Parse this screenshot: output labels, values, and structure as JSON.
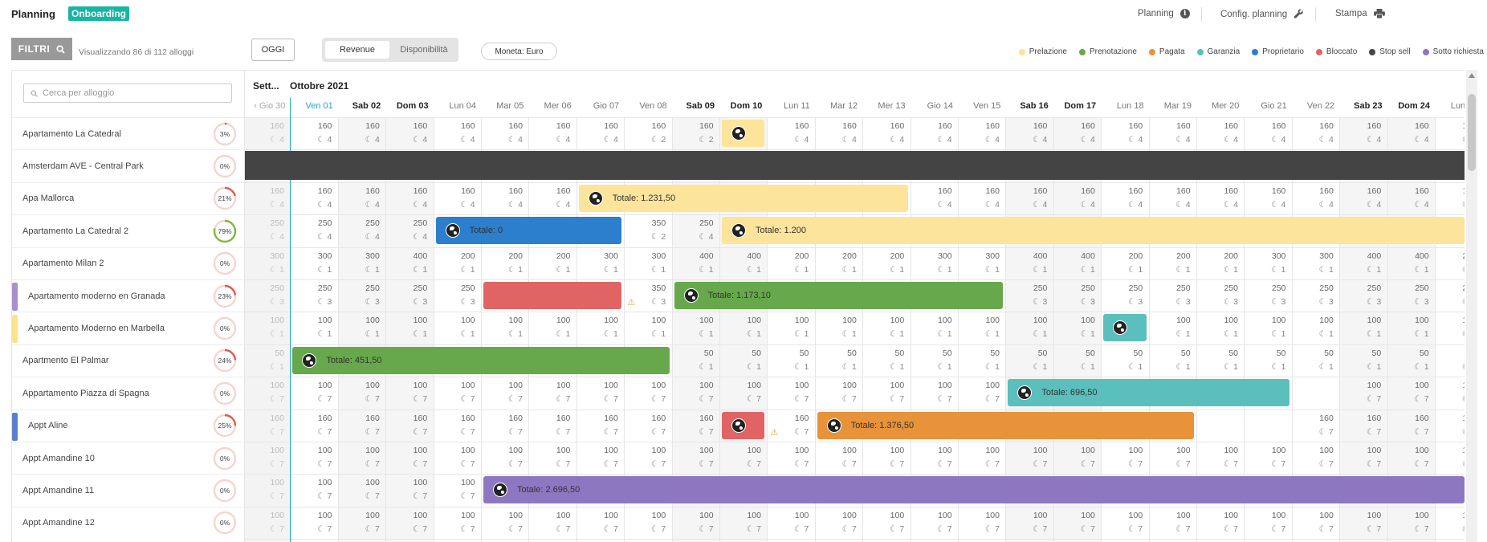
{
  "app": {
    "title": "Planning",
    "badge": "Onboarding"
  },
  "top_links": [
    {
      "label": "Planning",
      "icon": "info-icon"
    },
    {
      "label": "Config. planning",
      "icon": "wrench-icon"
    },
    {
      "label": "Stampa",
      "icon": "printer-icon"
    }
  ],
  "toolbar": {
    "filters_label": "FILTRI",
    "visual_text": "Visualizzando 86 di 112 alloggi",
    "today_label": "OGGI",
    "toggle": {
      "revenue": "Revenue",
      "availability": "Disponibilità",
      "active": "Revenue"
    },
    "currency": "Moneta: Euro"
  },
  "legend": [
    {
      "label": "Prelazione",
      "color": "#fde49b"
    },
    {
      "label": "Prenotazione",
      "color": "#67a84c"
    },
    {
      "label": "Pagata",
      "color": "#e8923a"
    },
    {
      "label": "Garanzia",
      "color": "#5bbfbd"
    },
    {
      "label": "Proprietario",
      "color": "#2b7fcc"
    },
    {
      "label": "Bloccato",
      "color": "#e06464"
    },
    {
      "label": "Stop sell",
      "color": "#444444"
    },
    {
      "label": "Sotto richiesta",
      "color": "#8e77c1"
    }
  ],
  "search": {
    "placeholder": "Cerca per alloggio"
  },
  "properties": [
    {
      "name": "Apartamento La Catedral",
      "pct": "3%",
      "pct_value": 3,
      "stripe": null
    },
    {
      "name": "Amsterdam AVE - Central Park",
      "pct": "0%",
      "pct_value": 0,
      "stripe": null
    },
    {
      "name": "Apa Mallorca",
      "pct": "21%",
      "pct_value": 21,
      "stripe": null
    },
    {
      "name": "Apartamento La Catedral 2",
      "pct": "79%",
      "pct_value": 79,
      "stripe": null
    },
    {
      "name": "Apartamento Milan 2",
      "pct": "0%",
      "pct_value": 0,
      "stripe": null
    },
    {
      "name": "Apartamento moderno en Granada",
      "pct": "23%",
      "pct_value": 23,
      "stripe": "#a98fcb"
    },
    {
      "name": "Apartamento Moderno en Marbella",
      "pct": "0%",
      "pct_value": 0,
      "stripe": "#fbe38d"
    },
    {
      "name": "Apartmento El Palmar",
      "pct": "24%",
      "pct_value": 24,
      "stripe": null
    },
    {
      "name": "Appartamento Piazza di Spagna",
      "pct": "0%",
      "pct_value": 0,
      "stripe": null
    },
    {
      "name": "Appt Aline",
      "pct": "25%",
      "pct_value": 25,
      "stripe": "#5b7fcf"
    },
    {
      "name": "Appt Amandine 10",
      "pct": "0%",
      "pct_value": 0,
      "stripe": null
    },
    {
      "name": "Appt Amandine 11",
      "pct": "0%",
      "pct_value": 0,
      "stripe": null
    },
    {
      "name": "Appt Amandine 12",
      "pct": "0%",
      "pct_value": 0,
      "stripe": null
    }
  ],
  "calendar": {
    "prev_month": "Sett...",
    "month": "Ottobre 2021",
    "days": [
      "Gio 30",
      "Ven 01",
      "Sab 02",
      "Dom 03",
      "Lun 04",
      "Mar 05",
      "Mer 06",
      "Gio 07",
      "Ven 08",
      "Sab 09",
      "Dom 10",
      "Lun 11",
      "Mar 12",
      "Mer 13",
      "Gio 14",
      "Ven 15",
      "Sab 16",
      "Dom 17",
      "Lun 18",
      "Mar 19",
      "Mer 20",
      "Gio 21",
      "Ven 22",
      "Sab 23",
      "Dom 24",
      "Lun 25"
    ],
    "weekend_idx": [
      2,
      3,
      9,
      10,
      16,
      17,
      23,
      24
    ],
    "today_idx": 1,
    "rows": [
      {
        "prices": [
          "160",
          "160",
          "160",
          "160",
          "160",
          "160",
          "160",
          "160",
          "160",
          "160",
          null,
          "160",
          "160",
          "160",
          "160",
          "160",
          "160",
          "160",
          "160",
          "160",
          "160",
          "160",
          "160",
          "160",
          "160",
          "160"
        ],
        "nights": [
          "4",
          "4",
          "4",
          "4",
          "4",
          "4",
          "4",
          "4",
          "2",
          "2",
          null,
          "4",
          "4",
          "4",
          "4",
          "4",
          "4",
          "4",
          "4",
          "4",
          "4",
          "4",
          "4",
          "4",
          "4",
          "1"
        ]
      },
      {
        "prices": [],
        "nights": []
      },
      {
        "prices": [
          "160",
          "160",
          "160",
          "160",
          "160",
          "160",
          "160",
          null,
          null,
          null,
          null,
          null,
          null,
          null,
          "160",
          "160",
          "160",
          "160",
          "160",
          "160",
          "160",
          "160",
          "160",
          "160",
          "160",
          "160"
        ],
        "nights": [
          "4",
          "4",
          "4",
          "4",
          "4",
          "4",
          "4",
          null,
          null,
          null,
          null,
          null,
          null,
          null,
          "4",
          "4",
          "4",
          "4",
          "4",
          "4",
          "4",
          "4",
          "4",
          "4",
          "4",
          "1"
        ]
      },
      {
        "prices": [
          "250",
          "250",
          "250",
          "250",
          null,
          null,
          null,
          null,
          "350",
          "250"
        ],
        "nights": [
          "4",
          "4",
          "4",
          "4",
          null,
          null,
          null,
          null,
          "2",
          "4"
        ]
      },
      {
        "prices": [
          "300",
          "300",
          "300",
          "400",
          "200",
          "200",
          "200",
          "300",
          "300",
          "400",
          "400",
          "200",
          "200",
          "200",
          "300",
          "300",
          "400",
          "400",
          "200",
          "200",
          "200",
          "300",
          "300",
          "400",
          "400",
          "200"
        ],
        "nights": [
          "1",
          "1",
          "1",
          "1",
          "1",
          "1",
          "1",
          "1",
          "1",
          "1",
          "1",
          "1",
          "1",
          "1",
          "1",
          "1",
          "1",
          "1",
          "1",
          "1",
          "1",
          "1",
          "1",
          "1",
          "1",
          "1"
        ]
      },
      {
        "prices": [
          "250",
          "250",
          "250",
          "250",
          "250",
          null,
          null,
          null,
          "350",
          null,
          null,
          null,
          null,
          null,
          null,
          null,
          "250",
          "250",
          "250",
          "250",
          "250",
          "250",
          "250",
          "250",
          "250",
          "250"
        ],
        "nights": [
          "3",
          "3",
          "3",
          "3",
          "3",
          null,
          null,
          null,
          "3",
          null,
          null,
          null,
          null,
          null,
          null,
          null,
          "3",
          "3",
          "3",
          "3",
          "3",
          "3",
          "3",
          "3",
          "3",
          "3"
        ]
      },
      {
        "prices": [
          "100",
          "100",
          "100",
          "100",
          "100",
          "100",
          "100",
          "100",
          "100",
          "100",
          "100",
          "100",
          "100",
          "100",
          "100",
          "100",
          "100",
          "100",
          null,
          "100",
          "100",
          "100",
          "100",
          "100",
          "100",
          "100"
        ],
        "nights": [
          "1",
          "1",
          "1",
          "1",
          "1",
          "1",
          "1",
          "1",
          "1",
          "1",
          "1",
          "1",
          "1",
          "1",
          "1",
          "1",
          "1",
          "1",
          null,
          "1",
          "1",
          "1",
          "1",
          "1",
          "1",
          "1"
        ]
      },
      {
        "prices": [
          "50",
          null,
          null,
          null,
          null,
          null,
          null,
          null,
          null,
          "50",
          "50",
          "50",
          "50",
          "50",
          "50",
          "50",
          "50",
          "50",
          "50",
          "50",
          "50",
          "50",
          "50",
          "50",
          "50",
          "50"
        ],
        "nights": [
          "1",
          null,
          null,
          null,
          null,
          null,
          null,
          null,
          null,
          "1",
          "1",
          "1",
          "1",
          "1",
          "1",
          "1",
          "1",
          "1",
          "1",
          "1",
          "1",
          "1",
          "1",
          "1",
          "1",
          "1"
        ]
      },
      {
        "prices": [
          "100",
          "100",
          "100",
          "100",
          "100",
          "100",
          "100",
          "100",
          "100",
          "100",
          "100",
          "100",
          "100",
          "100",
          "100",
          "100",
          null,
          null,
          null,
          null,
          null,
          null,
          null,
          "100",
          "100",
          "100"
        ],
        "nights": [
          "7",
          "7",
          "7",
          "7",
          "7",
          "7",
          "7",
          "7",
          "7",
          "7",
          "7",
          "7",
          "7",
          "7",
          "7",
          "7",
          null,
          null,
          null,
          null,
          null,
          null,
          null,
          "7",
          "7",
          "7"
        ]
      },
      {
        "prices": [
          "160",
          "160",
          "160",
          "160",
          "160",
          "160",
          "160",
          "160",
          "160",
          "160",
          null,
          "160",
          null,
          null,
          null,
          null,
          null,
          null,
          null,
          null,
          null,
          null,
          "160",
          "160",
          "160",
          "160"
        ],
        "nights": [
          "7",
          "7",
          "7",
          "7",
          "7",
          "7",
          "7",
          "7",
          "7",
          "7",
          null,
          "7",
          null,
          null,
          null,
          null,
          null,
          null,
          null,
          null,
          null,
          null,
          "7",
          "7",
          "7",
          "7"
        ]
      },
      {
        "prices": [
          "100",
          "100",
          "100",
          "100",
          "100",
          "100",
          "100",
          "100",
          "100",
          "100",
          "100",
          "100",
          "100",
          "100",
          "100",
          "100",
          "100",
          "100",
          "100",
          "100",
          "100",
          "100",
          "100",
          "100",
          "100",
          "100"
        ],
        "nights": [
          "7",
          "7",
          "7",
          "7",
          "7",
          "7",
          "7",
          "7",
          "7",
          "7",
          "7",
          "7",
          "7",
          "7",
          "7",
          "7",
          "7",
          "7",
          "7",
          "7",
          "7",
          "7",
          "7",
          "7",
          "7",
          "7"
        ]
      },
      {
        "prices": [
          "100",
          "100",
          "100",
          "100",
          "100"
        ],
        "nights": [
          "7",
          "7",
          "7",
          "7",
          "7"
        ]
      },
      {
        "prices": [
          "100",
          "100",
          "100",
          "100",
          "100",
          "100",
          "100",
          "100",
          "100",
          "100",
          "100",
          "100",
          "100",
          "100",
          "100",
          "100",
          "100",
          "100",
          "100",
          "100",
          "100",
          "100",
          "100",
          "100",
          "100",
          "100"
        ],
        "nights": [
          "7",
          "7",
          "7",
          "7",
          "7",
          "7",
          "7",
          "7",
          "7",
          "7",
          "7",
          "7",
          "7",
          "7",
          "7",
          "7",
          "7",
          "7",
          "7",
          "7",
          "7",
          "7",
          "7",
          "7",
          "7",
          "7"
        ]
      }
    ],
    "bookings": [
      {
        "row": 0,
        "from": 10,
        "to": 10,
        "color": "#fde49b",
        "label": ""
      },
      {
        "row": 2,
        "from": 7,
        "to": 13,
        "color": "#fde49b",
        "label": "Totale: 1.231,50"
      },
      {
        "row": 3,
        "from": 4,
        "to": 7,
        "color": "#2b7fcc",
        "label": "Totale: 0"
      },
      {
        "row": 3,
        "from": 10,
        "to": 25,
        "color": "#fde49b",
        "label": "Totale: 1.200"
      },
      {
        "row": 5,
        "from": 5,
        "to": 7,
        "color": "#e06464",
        "label": "",
        "noglobe": true
      },
      {
        "row": 5,
        "from": 9,
        "to": 15,
        "color": "#67a84c",
        "label": "Totale: 1.173,10"
      },
      {
        "row": 6,
        "from": 18,
        "to": 18,
        "color": "#5bbfbd",
        "label": ""
      },
      {
        "row": 7,
        "from": 1,
        "to": 8,
        "color": "#67a84c",
        "label": "Totale: 451,50"
      },
      {
        "row": 8,
        "from": 16,
        "to": 21,
        "color": "#5bbfbd",
        "label": "Totale: 696,50"
      },
      {
        "row": 9,
        "from": 10,
        "to": 10,
        "color": "#e06464",
        "label": ""
      },
      {
        "row": 9,
        "from": 12,
        "to": 19,
        "color": "#e8923a",
        "label": "Totale: 1.376,50"
      },
      {
        "row": 11,
        "from": 5,
        "to": 25,
        "color": "#8e77c1",
        "label": "Totale: 2.696,50"
      }
    ],
    "warnings": [
      {
        "row": 5,
        "col": 8
      },
      {
        "row": 9,
        "col": 11
      }
    ],
    "stop_sell_row": 1
  }
}
